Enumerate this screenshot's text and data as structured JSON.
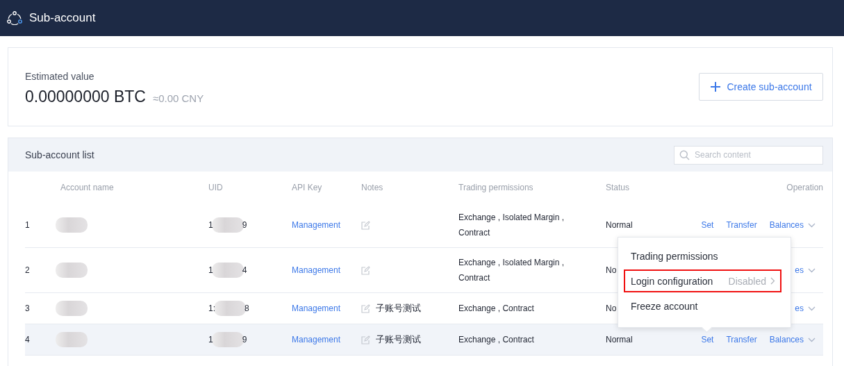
{
  "header": {
    "title": "Sub-account"
  },
  "summary": {
    "label": "Estimated value",
    "value": "0.00000000 BTC",
    "approx": "≈0.00 CNY",
    "create_button": "Create sub-account"
  },
  "list": {
    "title": "Sub-account list",
    "search": {
      "placeholder": "Search content"
    },
    "columns": [
      "Account name",
      "UID",
      "API Key",
      "Notes",
      "Trading permissions",
      "Status",
      "Operation"
    ],
    "rows": [
      {
        "index": "1",
        "uid_start": "1",
        "uid_end": "9",
        "api_key": "Management",
        "notes": "",
        "permissions": "Exchange , Isolated Margin , Contract",
        "status": "Normal",
        "selected": false,
        "operations": [
          {
            "label": "Set",
            "dropdown": false
          },
          {
            "label": "Transfer",
            "dropdown": false
          },
          {
            "label": "Balances",
            "dropdown": true
          }
        ]
      },
      {
        "index": "2",
        "uid_start": "1",
        "uid_end": "4",
        "api_key": "Management",
        "notes": "",
        "permissions": "Exchange , Isolated Margin , Contract",
        "status": "No",
        "selected": false,
        "operations": [
          {
            "label": "es",
            "dropdown": true
          }
        ]
      },
      {
        "index": "3",
        "uid_start": "1:",
        "uid_end": "8",
        "api_key": "Management",
        "notes": "子账号测试",
        "permissions": "Exchange , Contract",
        "status": "No",
        "selected": false,
        "operations": [
          {
            "label": "es",
            "dropdown": true
          }
        ]
      },
      {
        "index": "4",
        "uid_start": "1",
        "uid_end": "9",
        "api_key": "Management",
        "notes": "子账号测试",
        "permissions": "Exchange , Contract",
        "status": "Normal",
        "selected": true,
        "operations": [
          {
            "label": "Set",
            "dropdown": false
          },
          {
            "label": "Transfer",
            "dropdown": false
          },
          {
            "label": "Balances",
            "dropdown": true
          }
        ]
      }
    ]
  },
  "menu": {
    "items": [
      {
        "label": "Trading permissions",
        "highlighted": false
      },
      {
        "label": "Login configuration",
        "value": "Disabled",
        "highlighted": true
      },
      {
        "label": "Freeze account",
        "highlighted": false
      }
    ]
  }
}
